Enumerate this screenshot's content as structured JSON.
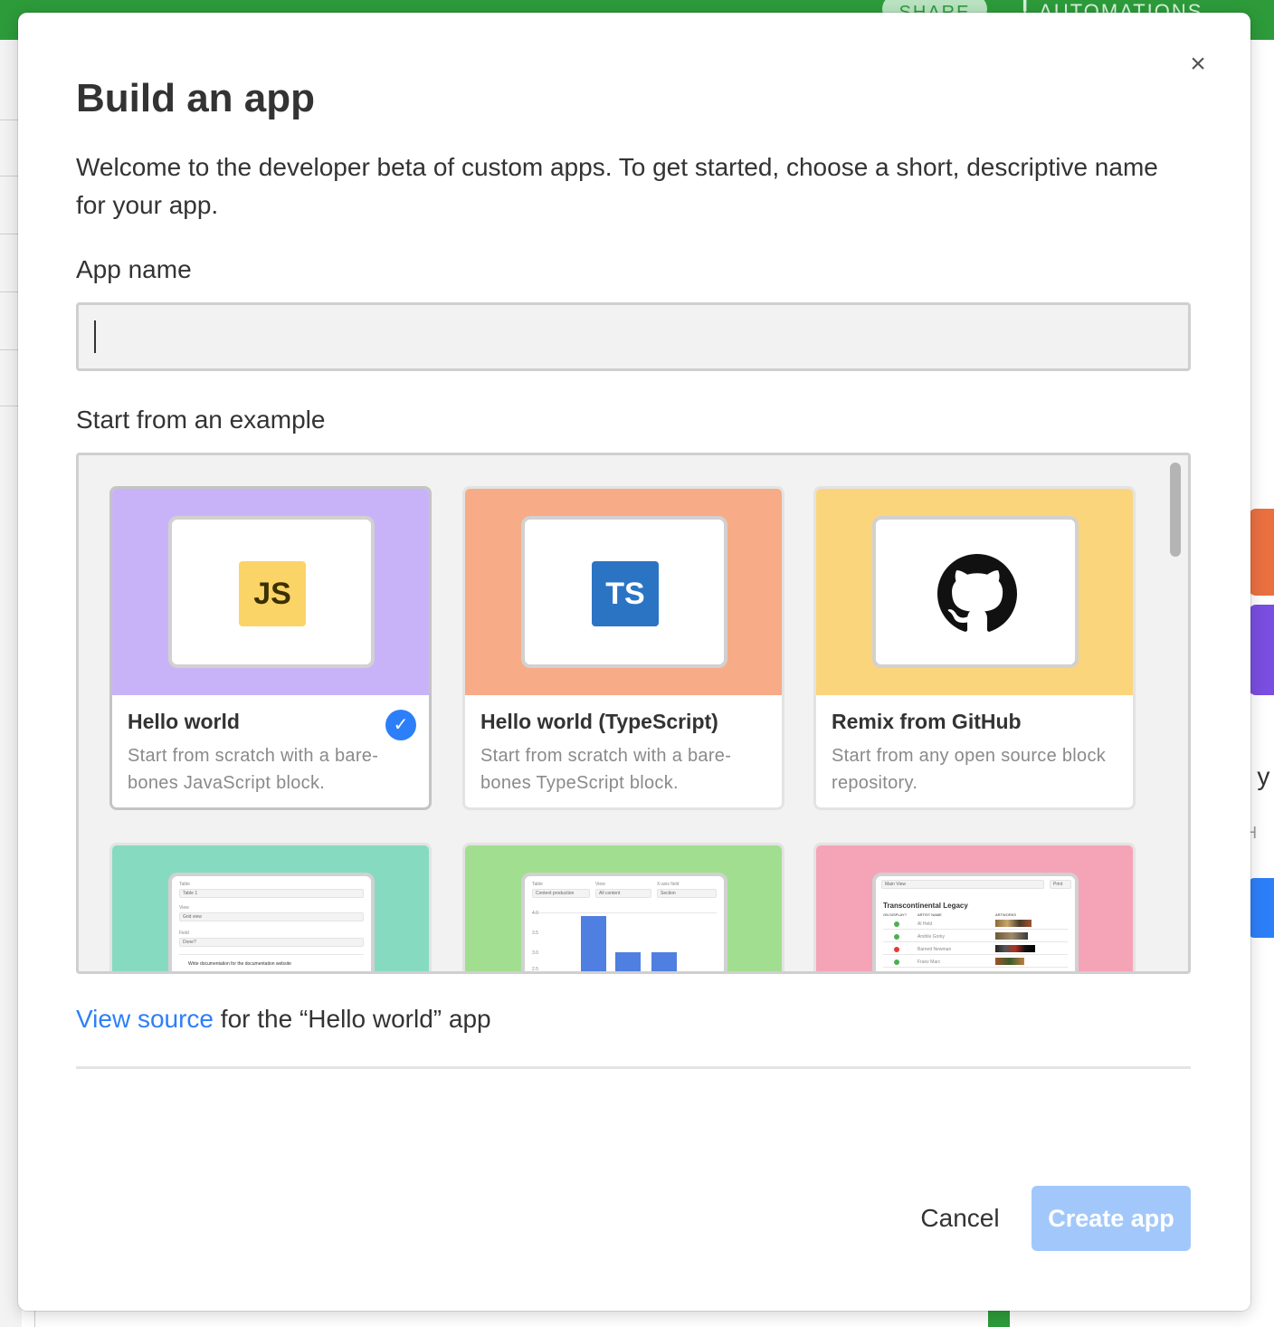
{
  "background": {
    "topbar": {
      "share_label": "SHARE",
      "automations_label": "AUTOMATIONS"
    },
    "side_fragment_text": "e y",
    "side_fragment_small": "H"
  },
  "modal": {
    "title": "Build an app",
    "description": "Welcome to the developer beta of custom apps. To get started, choose a short, descriptive name for your app.",
    "close_icon": "close-icon",
    "app_name_label": "App name",
    "app_name_value": "",
    "examples_label": "Start from an example",
    "examples": [
      {
        "title": "Hello world",
        "subtitle": "Start from scratch with a bare-bones JavaScript block.",
        "badge": "JS",
        "bg_color": "#c9b3f8",
        "badge_bg": "#fbd467",
        "badge_fg": "#3a3000",
        "selected": true
      },
      {
        "title": "Hello world (TypeScript)",
        "subtitle": "Start from scratch with a bare-bones TypeScript block.",
        "badge": "TS",
        "bg_color": "#f7ab86",
        "badge_bg": "#2b74c4",
        "badge_fg": "#ffffff",
        "selected": false
      },
      {
        "title": "Remix from GitHub",
        "subtitle": "Start from any open source block repository.",
        "icon": "github-icon",
        "bg_color": "#fbd57c",
        "selected": false
      },
      {
        "bg_color": "#86dac0",
        "preview": {
          "labels": [
            "Table",
            "View",
            "Field"
          ],
          "values": [
            "Table 1",
            "Grid view",
            "Done?"
          ],
          "row_text": "Write documentation for the documentation website"
        }
      },
      {
        "bg_color": "#a2de90",
        "preview": {
          "labels": [
            "Table",
            "View",
            "X-axis field"
          ],
          "values": [
            "Content production",
            "All content",
            "Section"
          ],
          "y_ticks": [
            "4.0",
            "3.5",
            "3.0",
            "2.5"
          ],
          "bars": [
            4.0,
            3.0,
            3.0
          ]
        }
      },
      {
        "bg_color": "#f5a3b6",
        "preview": {
          "view": "Main View",
          "print": "Print",
          "title": "Transcontinental Legacy",
          "columns": [
            "ON DISPLAY?",
            "ARTIST NAME",
            "ARTWORKS"
          ],
          "artists": [
            "Al Held",
            "Arshile Gorky",
            "Barnett Newman",
            "Franz Marc"
          ]
        }
      }
    ],
    "view_source_link": "View source",
    "view_source_rest": " for the “Hello world” app",
    "cancel_label": "Cancel",
    "create_label": "Create app",
    "accent": "#2d7ff9"
  }
}
